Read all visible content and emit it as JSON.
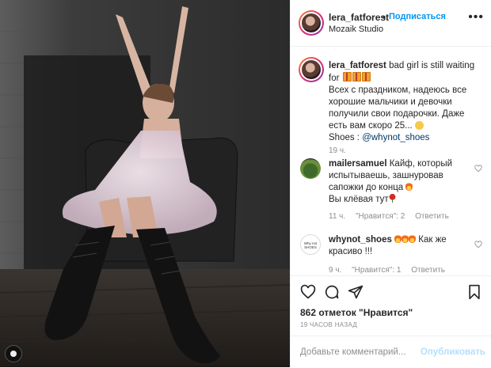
{
  "post": {
    "author": "lera_fatforest",
    "separator": "•",
    "follow_label": "Подписаться",
    "location": "Mozaik Studio",
    "more_label": "•••"
  },
  "caption": {
    "user": "lera_fatforest",
    "line1": "bad girl is still waiting for",
    "line2": "Всех с праздником, надеюсь все хорошие мальчики и девочки получили свои подарочки. Даже есть вам скоро 25...",
    "shoes_prefix": "Shoes : ",
    "shoes_link": "@whynot_shoes",
    "time": "19 ч."
  },
  "comments": [
    {
      "user": "mailersamuel",
      "text": "Кайф, который испытываешь, зашнуровав сапожки до конца",
      "text2": "Вы клёвая тут",
      "time": "11 ч.",
      "likes": "\"Нравится\": 2",
      "reply": "Ответить"
    },
    {
      "user": "whynot_shoes",
      "text": "Как же красиво !!!",
      "avatar_text": "Why not SHOES",
      "time": "9 ч.",
      "likes": "\"Нравится\": 1",
      "reply": "Ответить"
    }
  ],
  "stats": {
    "likes": "862 отметок \"Нравится\"",
    "ago": "19 ЧАСОВ НАЗАД"
  },
  "comment_box": {
    "placeholder": "Добавьте комментарий...",
    "publish": "Опубликовать"
  },
  "icons": [
    "heart-icon",
    "comment-icon",
    "share-icon",
    "bookmark-icon",
    "more-icon",
    "gift-emoji",
    "smile-emoji",
    "fire-emoji",
    "rose-emoji"
  ],
  "colors": {
    "accent": "#0095f6",
    "muted": "#8e8e8e",
    "link": "#00376b",
    "border": "#efefef"
  }
}
